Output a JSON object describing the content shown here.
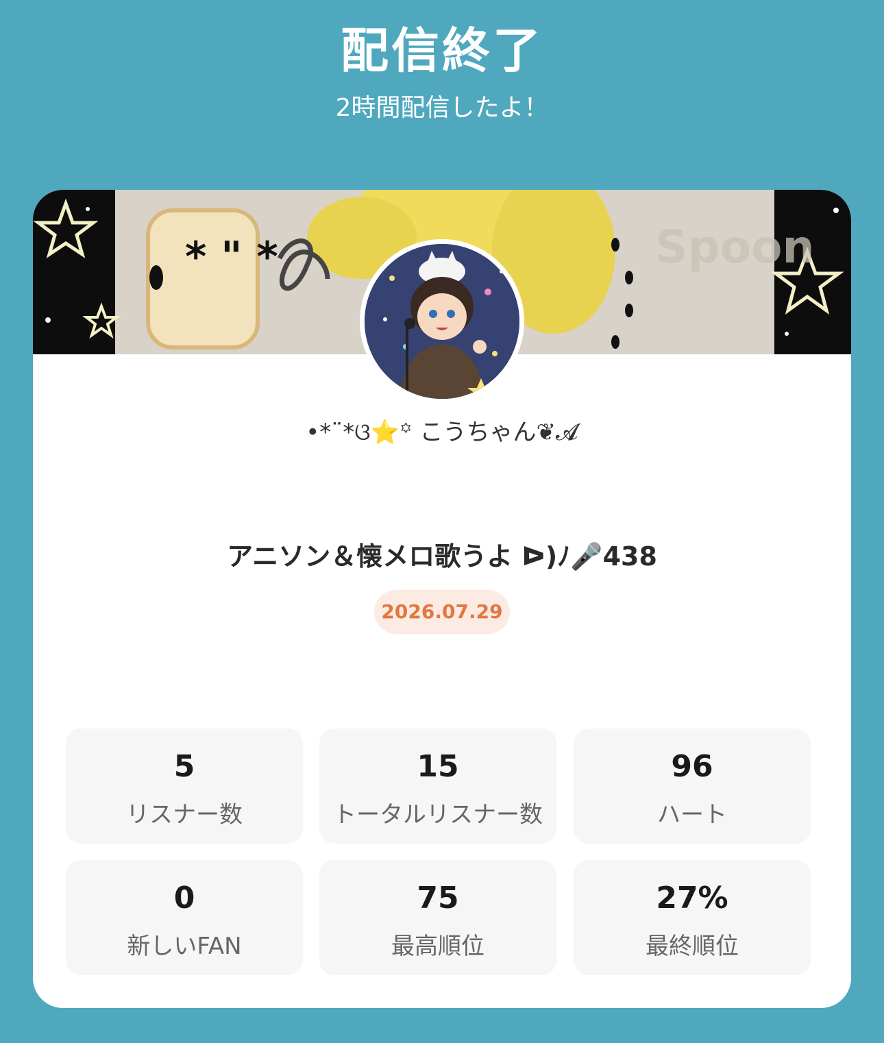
{
  "header": {
    "title": "配信終了",
    "subtitle": "2時間配信したよ！"
  },
  "banner": {
    "watermark": "Spoon"
  },
  "profile": {
    "username": "•*¨*ଓ⭐️꙳ こうちゃん❦𝓐"
  },
  "live": {
    "title": "アニソン＆懐メロ歌うよ ᐅ)ﾉ🎤438",
    "date": "2026.07.29"
  },
  "stats": [
    {
      "value": "5",
      "label": "リスナー数"
    },
    {
      "value": "15",
      "label": "トータルリスナー数"
    },
    {
      "value": "96",
      "label": "ハート"
    },
    {
      "value": "0",
      "label": "新しいFAN"
    },
    {
      "value": "75",
      "label": "最高順位"
    },
    {
      "value": "27%",
      "label": "最終順位"
    }
  ],
  "colors": {
    "background": "#4fa8bd",
    "card": "#ffffff",
    "date_badge_bg": "#fcebe2",
    "date_badge_text": "#e2773f",
    "stat_bg": "#f6f6f6"
  }
}
